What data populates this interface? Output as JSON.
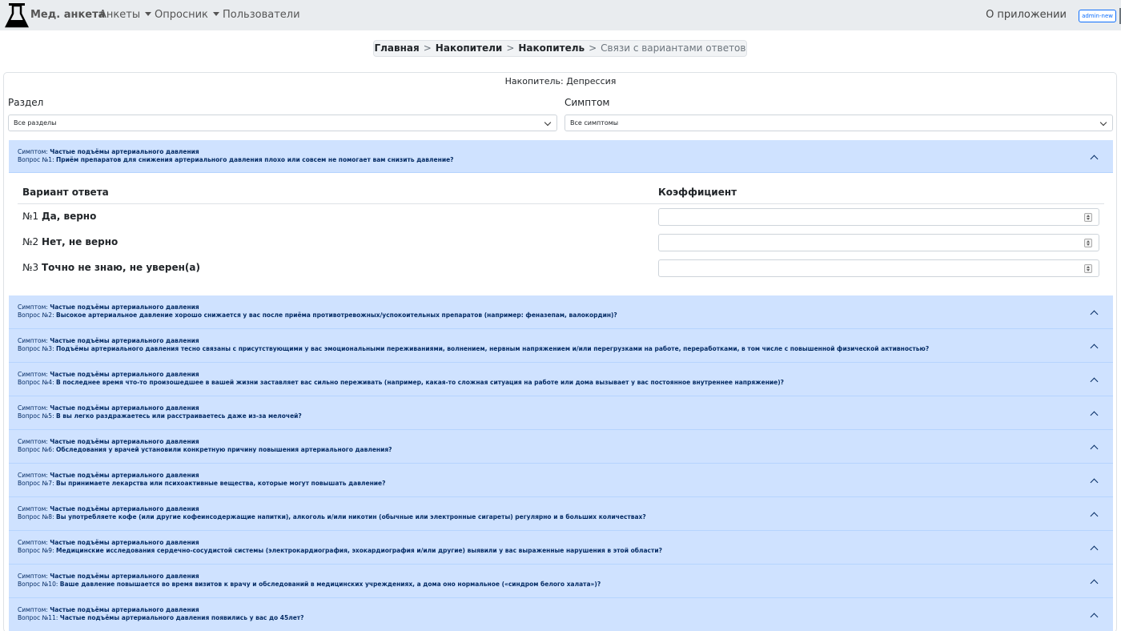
{
  "navbar": {
    "brand": "Мед. анкета",
    "items": [
      {
        "label": "Анкеты",
        "dropdown": true
      },
      {
        "label": "Опросник",
        "dropdown": true
      },
      {
        "label": "Пользователи",
        "dropdown": false
      }
    ],
    "about": "О приложении",
    "user": "admin-new"
  },
  "breadcrumb": {
    "items": [
      "Главная",
      "Накопители",
      "Накопитель"
    ],
    "current": "Связи с вариантами ответов",
    "separator": ">"
  },
  "card": {
    "title": "Накопитель: Депрессия",
    "section_label": "Раздел",
    "section_value": "Все разделы",
    "symptom_label": "Симптом",
    "symptom_value": "Все симптомы"
  },
  "accordion": {
    "symptom_prefix": "Симптом:",
    "items": [
      {
        "symptom": "Частые подъёмы артериального давления",
        "q_prefix": "Вопрос №1:",
        "question": "Приём препаратов для снижения артериального давления плохо или совсем не помогает вам снизить давление?"
      },
      {
        "symptom": "Частые подъёмы артериального давления",
        "q_prefix": "Вопрос №2:",
        "question": "Высокое артериальное давление хорошо снижается у вас после приёма противотревожных/успокоительных препаратов (например: феназепам, валокордин)?"
      },
      {
        "symptom": "Частые подъёмы артериального давления",
        "q_prefix": "Вопрос №3:",
        "question": "Подъёмы артериального давления тесно связаны с присутствующими у вас эмоциональными переживаниями, волнением, нервным напряжением и/или перегрузками на работе, переработками, в том числе с повышенной физической активностью?"
      },
      {
        "symptom": "Частые подъёмы артериального давления",
        "q_prefix": "Вопрос №4:",
        "question": "В последнее время что-то произошедшее в вашей жизни заставляет вас сильно переживать (например, какая-то сложная ситуация на работе или дома вызывает у вас постоянное внутреннее напряжение)?"
      },
      {
        "symptom": "Частые подъёмы артериального давления",
        "q_prefix": "Вопрос №5:",
        "question": "В вы легко раздражаетесь или расстраиваетесь даже из-за мелочей?"
      },
      {
        "symptom": "Частые подъёмы артериального давления",
        "q_prefix": "Вопрос №6:",
        "question": "Обследования у врачей установили конкретную причину повышения артериального давления?"
      },
      {
        "symptom": "Частые подъёмы артериального давления",
        "q_prefix": "Вопрос №7:",
        "question": "Вы принимаете лекарства или психоактивные вещества, которые могут повышать давление?"
      },
      {
        "symptom": "Частые подъёмы артериального давления",
        "q_prefix": "Вопрос №8:",
        "question": "Вы употребляете кофе (или другие кофеинсодержащие напитки), алкоголь и/или никотин (обычные или электронные сигареты) регулярно и в больших количествах?"
      },
      {
        "symptom": "Частые подъёмы артериального давления",
        "q_prefix": "Вопрос №9:",
        "question": "Медицинские исследования сердечно-сосудистой системы (электрокардиография, эхокардиография и/или другие) выявили у вас выраженные нарушения в этой области?"
      },
      {
        "symptom": "Частые подъёмы артериального давления",
        "q_prefix": "Вопрос №10:",
        "question": "Ваше давление повышается во время визитов к врачу и обследований в медицинских учреждениях, а дома оно нормальное («синдром белого халата»)?"
      },
      {
        "symptom": "Частые подъёмы артериального давления",
        "q_prefix": "Вопрос №11:",
        "question": "Частые подъёмы артериального давления появились у вас до 45лет?"
      }
    ]
  },
  "answers_table": {
    "col_answer": "Вариант ответа",
    "col_coef": "Коэффициент",
    "rows": [
      {
        "num": "№1",
        "text": "Да, верно",
        "value": ""
      },
      {
        "num": "№2",
        "text": "Нет, не верно",
        "value": ""
      },
      {
        "num": "№3",
        "text": "Точно не знаю, не уверен(а)",
        "value": ""
      }
    ]
  },
  "colors": {
    "navbar_bg": "#e9ecef",
    "accordion_bg": "#cfe2ff",
    "accordion_text": "#052c65",
    "badge": "#0d6efd"
  }
}
